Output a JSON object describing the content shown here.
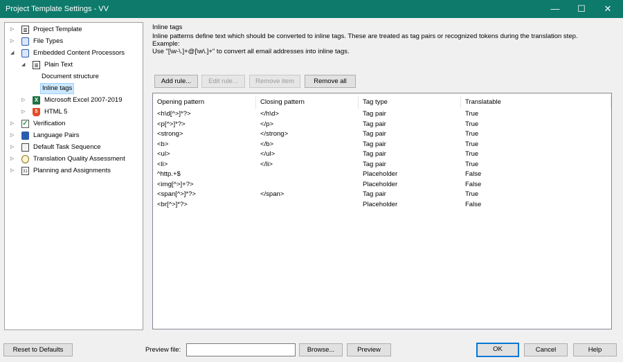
{
  "window": {
    "title": "Project Template Settings - VV",
    "minimize": "—",
    "maximize": "☐",
    "close": "✕"
  },
  "tree": {
    "items": [
      {
        "label": "Project Template",
        "expander": "▷",
        "icon": "document-icon"
      },
      {
        "label": "File Types",
        "expander": "▷",
        "icon": "gear-icon"
      },
      {
        "label": "Embedded Content Processors",
        "expander": "◢",
        "icon": "gear-icon"
      },
      {
        "label": "Plain Text",
        "expander": "◢",
        "icon": "document-icon"
      },
      {
        "label": "Document structure",
        "expander": "",
        "icon": ""
      },
      {
        "label": "Inline tags",
        "expander": "",
        "icon": ""
      },
      {
        "label": "Microsoft Excel 2007-2019",
        "expander": "▷",
        "icon": "excel-icon"
      },
      {
        "label": "HTML 5",
        "expander": "▷",
        "icon": "html5-icon"
      },
      {
        "label": "Verification",
        "expander": "▷",
        "icon": "check-icon"
      },
      {
        "label": "Language Pairs",
        "expander": "▷",
        "icon": "language-icon"
      },
      {
        "label": "Default Task Sequence",
        "expander": "▷",
        "icon": "task-icon"
      },
      {
        "label": "Translation Quality Assessment",
        "expander": "▷",
        "icon": "tqa-icon"
      },
      {
        "label": "Planning and Assignments",
        "expander": "▷",
        "icon": "calendar-icon"
      }
    ],
    "selected": "Inline tags"
  },
  "panel": {
    "title": "Inline tags",
    "description_line1": "Inline patterns define text which should be converted to inline tags. These are treated as tag pairs or recognized tokens during the translation step.",
    "description_line2": "Example:",
    "description_line3": "Use \"[\\w-\\.]+@[\\w\\.]+\" to convert all email addresses into inline tags.",
    "buttons": {
      "add_rule": "Add rule...",
      "edit_rule": "Edit rule...",
      "remove_item": "Remove item",
      "remove_all": "Remove all"
    }
  },
  "table": {
    "columns": [
      "Opening pattern",
      "Closing pattern",
      "Tag type",
      "Translatable"
    ],
    "rows": [
      [
        "<h\\d[^>]*?>",
        "</h\\d>",
        "Tag pair",
        "True"
      ],
      [
        "<p[^>]*?>",
        "</p>",
        "Tag pair",
        "True"
      ],
      [
        "<strong>",
        "</strong>",
        "Tag pair",
        "True"
      ],
      [
        "<b>",
        "</b>",
        "Tag pair",
        "True"
      ],
      [
        "<ul>",
        "</ul>",
        "Tag pair",
        "True"
      ],
      [
        "<li>",
        "</li>",
        "Tag pair",
        "True"
      ],
      [
        "^http.+$",
        "",
        "Placeholder",
        "False"
      ],
      [
        "<img[^>]+?>",
        "",
        "Placeholder",
        "False"
      ],
      [
        "<span[^>]*?>",
        "</span>",
        "Tag pair",
        "True"
      ],
      [
        "<br[^>]*?>",
        "",
        "Placeholder",
        "False"
      ]
    ]
  },
  "footer": {
    "reset": "Reset to Defaults",
    "preview_label": "Preview file:",
    "preview_value": "",
    "browse": "Browse...",
    "preview": "Preview",
    "ok": "OK",
    "cancel": "Cancel",
    "help": "Help"
  },
  "colors": {
    "titlebar": "#0d7a6b",
    "selection": "#cce8ff",
    "focus_border": "#0078d7"
  }
}
